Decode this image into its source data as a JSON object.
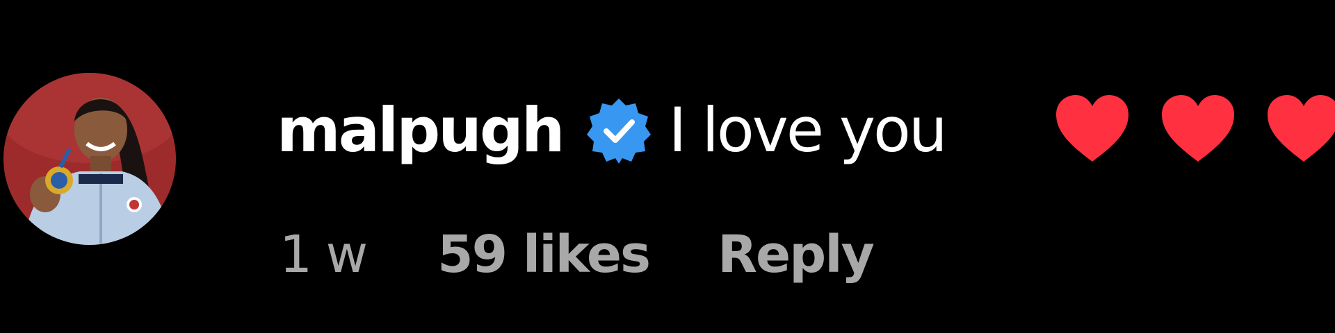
{
  "comment": {
    "username": "malpugh",
    "verified_icon": "verified-badge-icon",
    "text": "I love you",
    "emoji": [
      "heart",
      "heart",
      "heart"
    ],
    "meta": {
      "timestamp": "1 w",
      "likes": "59 likes",
      "reply": "Reply"
    }
  },
  "colors": {
    "background": "#000000",
    "text_primary": "#ffffff",
    "text_secondary": "#a8a8a8",
    "verified_blue": "#3897f0",
    "heart_red": "#ff3040",
    "avatar_bg": "#9e2b2b"
  }
}
